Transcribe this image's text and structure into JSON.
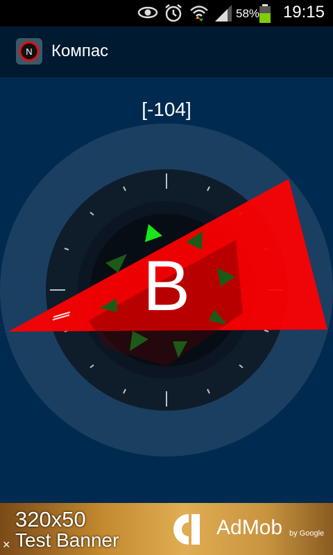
{
  "status_bar": {
    "time": "19:15",
    "battery_percent": "58%",
    "icons": [
      "eye-icon",
      "alarm-icon",
      "wifi-icon",
      "signal-icon",
      "battery-icon"
    ]
  },
  "action_bar": {
    "title": "Компас",
    "icon": "compass-app-icon"
  },
  "compass": {
    "heading": "[-104]",
    "direction_letter": "В",
    "colors": {
      "background": "#002a4f",
      "dial": "#0f1c2a",
      "pointer": "#ff0000",
      "north_marker": "#19e619",
      "markers": "#1d5a17"
    }
  },
  "ad_banner": {
    "size_label": "320x50",
    "label": "Test Banner",
    "brand": "AdMob",
    "brand_sub": "by Google",
    "close_glyph": "×"
  }
}
